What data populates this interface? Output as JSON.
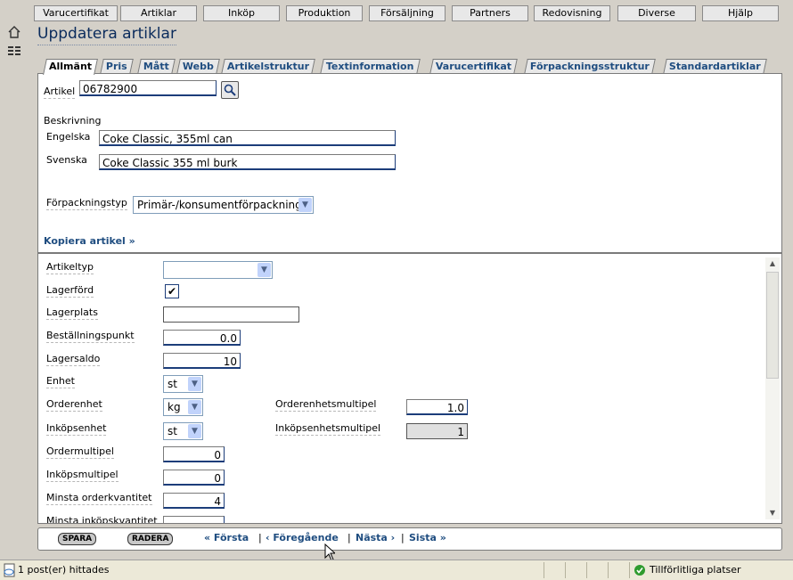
{
  "menu": [
    "Varucertifikat",
    "Artiklar",
    "Inköp",
    "Produktion",
    "Försäljning",
    "Partners",
    "Redovisning",
    "Diverse",
    "Hjälp"
  ],
  "left_icons": [
    "home-icon",
    "list-icon"
  ],
  "page_title": "Uppdatera artiklar",
  "tabs": [
    "Allmänt",
    "Pris",
    "Mått",
    "Webb",
    "Artikelstruktur",
    "Textinformation",
    "Varucertifikat",
    "Förpackningsstruktur",
    "Standardartiklar"
  ],
  "active_tab": "Allmänt",
  "general": {
    "artikel_label": "Artikel",
    "artikel_value": "06782900",
    "beskrivning_label": "Beskrivning",
    "engelska_label": "Engelska",
    "engelska_value": "Coke Classic, 355ml can",
    "svenska_label": "Svenska",
    "svenska_value": "Coke Classic 355 ml burk",
    "forpackningstyp_label": "Förpackningstyp",
    "forpackningstyp_value": "Primär-/konsumentförpackning",
    "kopiera_link": "Kopiera artikel »"
  },
  "details": {
    "artikeltyp_label": "Artikeltyp",
    "artikeltyp_value": "",
    "lagerford_label": "Lagerförd",
    "lagerford_checked": true,
    "lagerplats_label": "Lagerplats",
    "lagerplats_value": "",
    "bestallningspunkt_label": "Beställningspunkt",
    "bestallningspunkt_value": "0.0",
    "lagersaldo_label": "Lagersaldo",
    "lagersaldo_value": "10",
    "enhet_label": "Enhet",
    "enhet_value": "st",
    "orderenhet_label": "Orderenhet",
    "orderenhet_value": "kg",
    "orderenhetsmultipel_label": "Orderenhetsmultipel",
    "orderenhetsmultipel_value": "1.0",
    "inkopsenhet_label": "Inköpsenhet",
    "inkopsenhet_value": "st",
    "inkopsenhetsmultipel_label": "Inköpsenhetsmultipel",
    "inkopsenhetsmultipel_value": "1",
    "ordermultipel_label": "Ordermultipel",
    "ordermultipel_value": "0",
    "inkopsmultipel_label": "Inköpsmultipel",
    "inkopsmultipel_value": "0",
    "minsta_orderkvantitet_label": "Minsta orderkvantitet",
    "minsta_orderkvantitet_value": "4",
    "minsta_inkopskvantitet_label": "Minsta inköpskvantitet"
  },
  "actions": {
    "spara": "SPARA",
    "radera": "RADERA",
    "forsta": "« Första",
    "foregaende": "‹ Föregående",
    "nasta": "Nästa ›",
    "sista": "Sista »",
    "sep": "|"
  },
  "status": {
    "message": "1 post(er) hittades",
    "zone": "Tillförlitliga platser"
  },
  "colors": {
    "link": "#1f4d80",
    "title": "#0a2b5c",
    "background": "#d4d0c8"
  }
}
